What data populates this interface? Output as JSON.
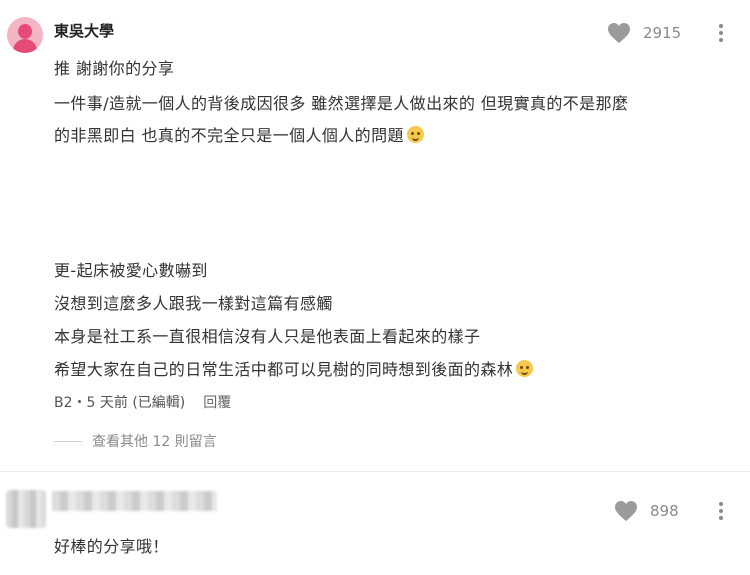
{
  "comment1": {
    "author": "東吳大學",
    "likes": "2915",
    "lines": [
      "推 謝謝你的分享",
      "一件事/造就一個人的背後成因很多 雖然選擇是人做出來的 但現實真的不是那麼",
      "的非黑即白 也真的不完全只是一個人個人的問題",
      "更-起床被愛心數嚇到",
      "沒想到這麼多人跟我一樣對這篇有感觸",
      "本身是社工系一直很相信沒有人只是他表面上看起來的樣子",
      "希望大家在自己的日常生活中都可以見樹的同時想到後面的森林"
    ],
    "meta": "B2・5 天前 (已編輯)",
    "reply_label": "回覆",
    "view_replies": "查看其他 12 則留言",
    "emoji_1": "pleading-face-emoji",
    "emoji_2": "smiling-face-emoji"
  },
  "comment2": {
    "likes": "898",
    "text": "好棒的分享哦！"
  },
  "colors": {
    "text": "#333333",
    "muted": "#8a8a8a",
    "avatar_bg": "#f4b6c2",
    "avatar_fg": "#e64a79"
  }
}
